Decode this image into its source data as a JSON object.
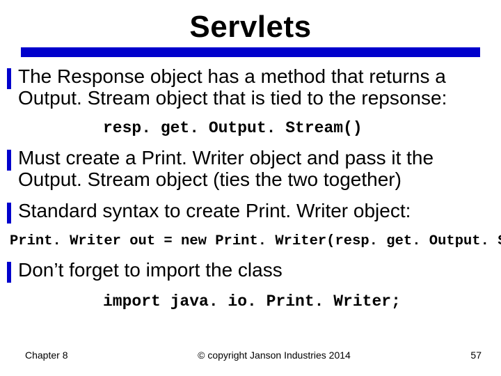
{
  "title": "Servlets",
  "bullets": [
    "The Response object has a method that returns a Output. Stream object that is tied to the repsonse:",
    "Must create a Print. Writer object and pass it the Output. Stream object (ties the two together)",
    "Standard syntax to create Print. Writer object:",
    "Don’t forget to import the class"
  ],
  "code": {
    "getOutput": "resp. get. Output. Stream()",
    "printWriter": "Print. Writer out = new Print. Writer(resp. get. Output. Stream());",
    "importStmt": "import java. io. Print. Writer;"
  },
  "footer": {
    "left": "Chapter 8",
    "center": "© copyright Janson Industries 2014",
    "right": "57"
  }
}
